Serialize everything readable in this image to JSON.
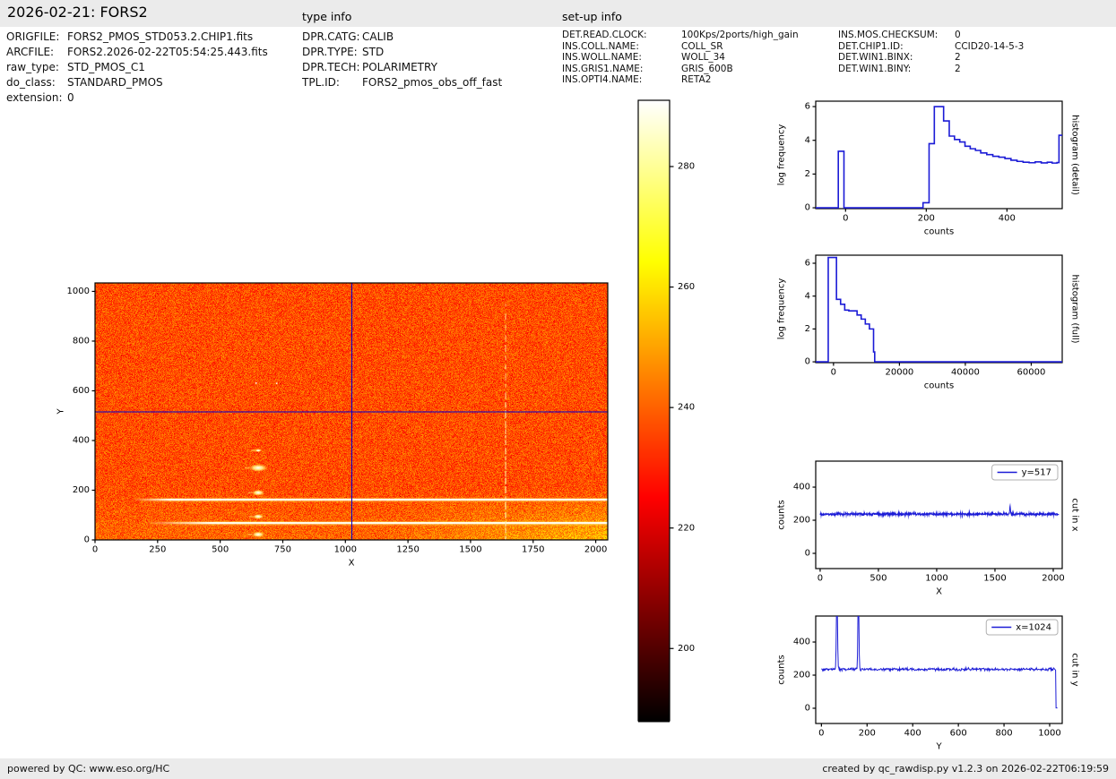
{
  "header": {
    "title": "2026-02-21: FORS2",
    "type_info_title": "type info",
    "setup_info_title": "set-up info"
  },
  "file_info": {
    "rows": [
      {
        "label": "ORIGFILE:",
        "value": "FORS2_PMOS_STD053.2.CHIP1.fits"
      },
      {
        "label": "ARCFILE:",
        "value": "FORS2.2026-02-22T05:54:25.443.fits"
      },
      {
        "label": "raw_type:",
        "value": "STD_PMOS_C1"
      },
      {
        "label": "do_class:",
        "value": "STANDARD_PMOS"
      },
      {
        "label": "extension:",
        "value": "0"
      }
    ]
  },
  "type_info": {
    "rows": [
      {
        "label": "DPR.CATG:",
        "value": "CALIB"
      },
      {
        "label": "DPR.TYPE:",
        "value": "STD"
      },
      {
        "label": "DPR.TECH:",
        "value": "POLARIMETRY"
      },
      {
        "label": "TPL.ID:",
        "value": "FORS2_pmos_obs_off_fast"
      }
    ]
  },
  "setup_info": {
    "col1": [
      {
        "label": "DET.READ.CLOCK:",
        "value": "100Kps/2ports/high_gain"
      },
      {
        "label": "INS.COLL.NAME:",
        "value": "COLL_SR"
      },
      {
        "label": "INS.WOLL.NAME:",
        "value": "WOLL_34"
      },
      {
        "label": "INS.GRIS1.NAME:",
        "value": "GRIS_600B"
      },
      {
        "label": "INS.OPTI4.NAME:",
        "value": "RETA2"
      }
    ],
    "col2": [
      {
        "label": "INS.MOS.CHECKSUM:",
        "value": "0"
      },
      {
        "label": "DET.CHIP1.ID:",
        "value": "CCID20-14-5-3"
      },
      {
        "label": "DET.WIN1.BINX:",
        "value": "2"
      },
      {
        "label": "DET.WIN1.BINY:",
        "value": "2"
      }
    ]
  },
  "footer": {
    "left": "powered by QC: www.eso.org/HC",
    "right": "created by qc_rawdisp.py v1.2.3 on 2026-02-22T06:19:59"
  },
  "colors": {
    "plot_line": "#1b1bd6",
    "crosshair": "#0000cf",
    "bar_bg": "#ebebeb",
    "axes": "#000000"
  },
  "chart_data": [
    {
      "id": "main_image",
      "type": "heatmap",
      "xlabel": "X",
      "ylabel": "Y",
      "xlim": [
        0,
        2048
      ],
      "ylim": [
        0,
        1034
      ],
      "xticks": [
        0,
        250,
        500,
        750,
        1000,
        1250,
        1500,
        1750,
        2000
      ],
      "yticks": [
        0,
        200,
        400,
        600,
        800,
        1000
      ],
      "colormap": "hot",
      "vmin": 188,
      "vmax": 291,
      "background_counts": 237,
      "seed": 1234,
      "crosshair": {
        "x": 1024,
        "y": 517
      },
      "features": {
        "horizontal_lines": [
          {
            "y": 162,
            "x_faint_start": 150,
            "x_full": 300,
            "counts": 291
          },
          {
            "y": 68,
            "x_faint_start": 200,
            "x_full": 460,
            "counts": 291
          }
        ],
        "vertical_line": {
          "x": 1640,
          "y_range": [
            10,
            950
          ],
          "counts": 270,
          "dashed_above": 600
        },
        "blob_column_x": 652,
        "blobs": [
          {
            "y": 360,
            "w": 8,
            "h": 4
          },
          {
            "y": 290,
            "w": 22,
            "h": 9
          },
          {
            "y": 190,
            "w": 15,
            "h": 7
          },
          {
            "y": 94,
            "w": 13,
            "h": 6
          },
          {
            "y": 22,
            "w": 15,
            "h": 7
          }
        ],
        "dots": [
          {
            "x": 641,
            "y": 634
          },
          {
            "x": 723,
            "y": 633
          }
        ],
        "bright_bottom": {
          "below_y": 205,
          "extra_counts_left": 4,
          "extra_counts_right": 13
        }
      }
    },
    {
      "id": "colorbar",
      "type": "colorbar",
      "colormap": "hot",
      "vmin": 188,
      "vmax": 291,
      "ticks": [
        200,
        220,
        240,
        260,
        280
      ]
    },
    {
      "id": "hist_detail",
      "type": "step",
      "xlabel": "counts",
      "ylabel": "log frequency",
      "right_label": "histogram (detail)",
      "xlim": [
        -74,
        537
      ],
      "ylim": [
        -0.05,
        6.32
      ],
      "xticks": [
        0,
        200,
        400
      ],
      "yticks": [
        0,
        2,
        4,
        6
      ],
      "points": [
        [
          -74,
          0
        ],
        [
          -18,
          0
        ],
        [
          -18,
          3.35
        ],
        [
          -4,
          3.35
        ],
        [
          -4,
          0
        ],
        [
          192,
          0
        ],
        [
          192,
          0.3
        ],
        [
          207,
          0.3
        ],
        [
          207,
          3.8
        ],
        [
          220,
          3.8
        ],
        [
          220,
          6.0
        ],
        [
          243,
          6.0
        ],
        [
          243,
          5.15
        ],
        [
          257,
          5.15
        ],
        [
          257,
          4.25
        ],
        [
          270,
          4.25
        ],
        [
          270,
          4.05
        ],
        [
          283,
          4.05
        ],
        [
          283,
          3.9
        ],
        [
          296,
          3.9
        ],
        [
          296,
          3.65
        ],
        [
          309,
          3.65
        ],
        [
          309,
          3.5
        ],
        [
          322,
          3.5
        ],
        [
          322,
          3.4
        ],
        [
          335,
          3.4
        ],
        [
          335,
          3.25
        ],
        [
          350,
          3.25
        ],
        [
          350,
          3.15
        ],
        [
          365,
          3.15
        ],
        [
          365,
          3.05
        ],
        [
          380,
          3.05
        ],
        [
          380,
          3.0
        ],
        [
          395,
          3.0
        ],
        [
          395,
          2.92
        ],
        [
          410,
          2.92
        ],
        [
          410,
          2.82
        ],
        [
          425,
          2.82
        ],
        [
          425,
          2.75
        ],
        [
          440,
          2.75
        ],
        [
          440,
          2.7
        ],
        [
          455,
          2.7
        ],
        [
          455,
          2.67
        ],
        [
          470,
          2.67
        ],
        [
          470,
          2.72
        ],
        [
          485,
          2.72
        ],
        [
          485,
          2.66
        ],
        [
          500,
          2.66
        ],
        [
          500,
          2.7
        ],
        [
          512,
          2.7
        ],
        [
          512,
          2.65
        ],
        [
          524,
          2.65
        ],
        [
          524,
          2.68
        ],
        [
          529,
          2.68
        ],
        [
          529,
          4.3
        ],
        [
          537,
          4.3
        ]
      ]
    },
    {
      "id": "hist_full",
      "type": "step",
      "xlabel": "counts",
      "ylabel": "log frequency",
      "right_label": "histogram (full)",
      "xlim": [
        -5400,
        69400
      ],
      "ylim": [
        -0.05,
        6.49
      ],
      "xticks": [
        0,
        20000,
        40000,
        60000
      ],
      "yticks": [
        0,
        2,
        4,
        6
      ],
      "points": [
        [
          -5400,
          0
        ],
        [
          -1600,
          0
        ],
        [
          -1600,
          6.35
        ],
        [
          900,
          6.35
        ],
        [
          900,
          3.8
        ],
        [
          2150,
          3.8
        ],
        [
          2150,
          3.5
        ],
        [
          3400,
          3.5
        ],
        [
          3400,
          3.15
        ],
        [
          4650,
          3.15
        ],
        [
          4650,
          3.1
        ],
        [
          7150,
          3.1
        ],
        [
          7150,
          2.85
        ],
        [
          8400,
          2.85
        ],
        [
          8400,
          2.6
        ],
        [
          9650,
          2.6
        ],
        [
          9650,
          2.3
        ],
        [
          10900,
          2.3
        ],
        [
          10900,
          2.0
        ],
        [
          12150,
          2.0
        ],
        [
          12150,
          0.6
        ],
        [
          12500,
          0.6
        ],
        [
          12500,
          0
        ],
        [
          69400,
          0
        ]
      ]
    },
    {
      "id": "cut_x",
      "type": "noisy_line",
      "xlabel": "X",
      "ylabel": "counts",
      "right_label": "cut in x",
      "legend": "y=517",
      "xlim": [
        -38,
        2077
      ],
      "ylim": [
        -92,
        557
      ],
      "xticks": [
        0,
        500,
        1000,
        1500,
        2000
      ],
      "yticks": [
        0,
        200,
        400
      ],
      "x_range": [
        0,
        2048
      ],
      "baseline": 237,
      "noise_amp": 9,
      "seed": 77,
      "spikes": [
        {
          "x": 1630,
          "amp": 52,
          "sigma": 3
        }
      ],
      "end_drop": null
    },
    {
      "id": "cut_y",
      "type": "noisy_line",
      "xlabel": "Y",
      "ylabel": "counts",
      "right_label": "cut in y",
      "legend": "x=1024",
      "xlim": [
        -25,
        1055
      ],
      "ylim": [
        -92,
        557
      ],
      "xticks": [
        0,
        200,
        400,
        600,
        800,
        1000
      ],
      "yticks": [
        0,
        200,
        400
      ],
      "x_range": [
        0,
        1034
      ],
      "baseline": 235,
      "noise_amp": 10,
      "seed": 99,
      "spikes": [
        {
          "x": 68,
          "amp": 480,
          "sigma": 2.4
        },
        {
          "x": 162,
          "amp": 480,
          "sigma": 2.2
        }
      ],
      "end_drop": {
        "x": 1028,
        "value": 2
      }
    }
  ]
}
